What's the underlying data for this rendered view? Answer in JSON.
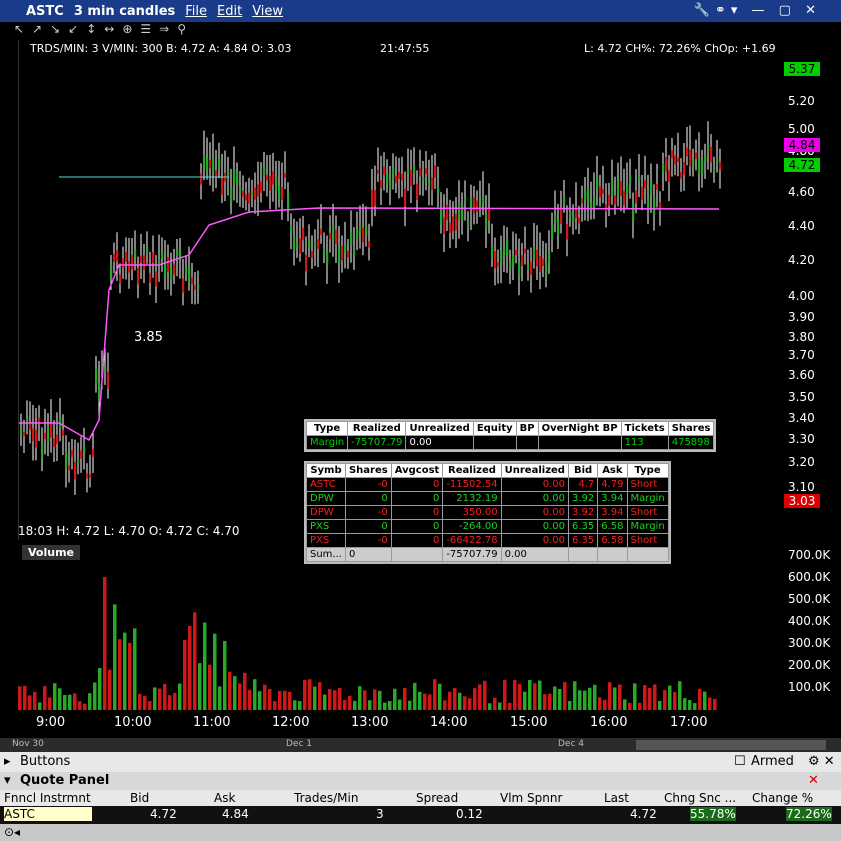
{
  "menubar": {
    "symbol": "ASTC",
    "interval": "3 min candles",
    "menu": [
      "File",
      "Edit",
      "View"
    ]
  },
  "info": {
    "left": "TRDS/MIN: 3 V/MIN: 300 B: 4.72 A: 4.84 O: 3.03",
    "time": "21:47:55",
    "right": "L: 4.72 CH%: 72.26% ChOp: +1.69"
  },
  "ohlc": "18:03   H: 4.72  L: 4.70  O: 4.72  C: 4.70",
  "annotation_low": "3.85",
  "yticks": [
    "5.20",
    "5.00",
    "4.80",
    "4.60",
    "4.40",
    "4.20",
    "4.00",
    "3.90",
    "3.80",
    "3.70",
    "3.60",
    "3.50",
    "3.40",
    "3.30",
    "3.20",
    "3.10"
  ],
  "price_tags": {
    "high": "5.37",
    "ask": "4.84",
    "last": "4.72",
    "low": "3.03"
  },
  "volume_label": "Volume",
  "vol_ticks": [
    "700.0K",
    "600.0K",
    "500.0K",
    "400.0K",
    "300.0K",
    "200.0K",
    "100.0K"
  ],
  "xticks": [
    "9:00",
    "10:00",
    "11:00",
    "12:00",
    "13:00",
    "14:00",
    "15:00",
    "16:00",
    "17:00"
  ],
  "scroll_dates": [
    "Nov 30",
    "Dec 1",
    "Dec 4"
  ],
  "account": {
    "headers": [
      "Type",
      "Realized",
      "Unrealized",
      "Equity",
      "BP",
      "OverNight BP",
      "Tickets",
      "Shares"
    ],
    "row": [
      "Margin",
      "-75707.79",
      "0.00",
      "",
      "",
      "",
      "113",
      "475898"
    ]
  },
  "positions": {
    "headers": [
      "Symb",
      "Shares",
      "Avgcost",
      "Realized",
      "Unrealized",
      "Bid",
      "Ask",
      "Type"
    ],
    "rows": [
      [
        "ASTC",
        "-0",
        "0",
        "-11502.54",
        "0.00",
        "4.7",
        "4.79",
        "Short"
      ],
      [
        "DPW",
        "0",
        "0",
        "2132.19",
        "0.00",
        "3.92",
        "3.94",
        "Margin"
      ],
      [
        "DPW",
        "-0",
        "0",
        "350.00",
        "0.00",
        "3.92",
        "3.94",
        "Short"
      ],
      [
        "PXS",
        "0",
        "0",
        "-264.00",
        "0.00",
        "6.35",
        "6.58",
        "Margin"
      ],
      [
        "PXS",
        "-0",
        "0",
        "-66422.78",
        "0.00",
        "6.35",
        "6.58",
        "Short"
      ]
    ],
    "sum": [
      "Sum...",
      "0",
      "",
      "-75707.79",
      "0.00",
      "",
      "",
      ""
    ]
  },
  "buttons": {
    "label": "Buttons",
    "armed": "Armed"
  },
  "quote_panel": {
    "title": "Quote Panel",
    "headers": [
      "Fnncl Instrmnt",
      "Bid",
      "Ask",
      "Trades/Min",
      "Spread",
      "Vlm Spnnr",
      "Last",
      "Chng Snc ...",
      "Change %"
    ],
    "row": [
      "ASTC",
      "4.72",
      "4.84",
      "3",
      "0.12",
      "",
      "4.72",
      "55.78%",
      "72.26%"
    ]
  },
  "colors": {
    "up": "#2aa82a",
    "down": "#d01818",
    "vwap": "#ff55ff",
    "line": "#55e0e0"
  }
}
